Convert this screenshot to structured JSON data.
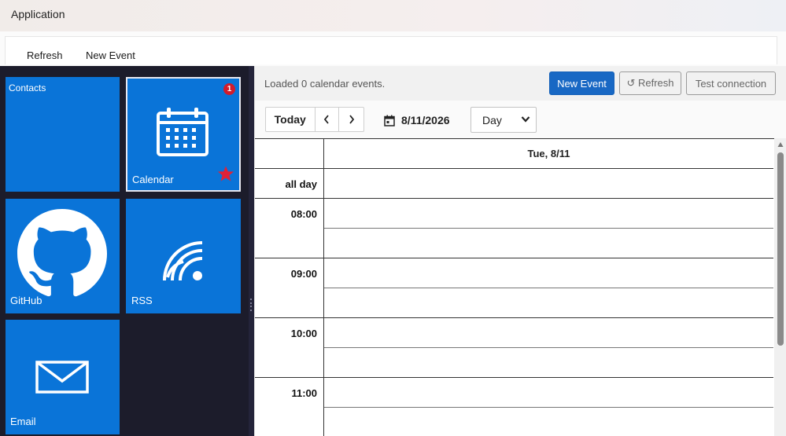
{
  "window": {
    "title": "Application"
  },
  "commandbar": {
    "refresh_label": "Refresh",
    "new_event_label": "New Event"
  },
  "tiles": {
    "contacts": {
      "label": "Contacts"
    },
    "calendar": {
      "label": "Calendar",
      "badge": "1",
      "favorite": true
    },
    "github": {
      "label": "GitHub"
    },
    "rss": {
      "label": "RSS"
    },
    "email": {
      "label": "Email"
    }
  },
  "main": {
    "status": "Loaded 0 calendar events.",
    "new_event_label": "New Event",
    "refresh_label": "↺ Refresh",
    "test_label": "Test connection"
  },
  "toolbar": {
    "today_label": "Today",
    "prev_icon": "chevron-left-icon",
    "next_icon": "chevron-right-icon",
    "date": "8/11/2026",
    "view": "Day"
  },
  "grid": {
    "day_header": "Tue, 8/11",
    "all_day_label": "all day",
    "hours": [
      "08:00",
      "09:00",
      "10:00",
      "11:00"
    ]
  },
  "colors": {
    "tile": "#0a74d8",
    "tile_pane": "#1c1c2b",
    "primary_button": "#1868c4",
    "badge": "#d21c2c",
    "star": "#e02236"
  }
}
